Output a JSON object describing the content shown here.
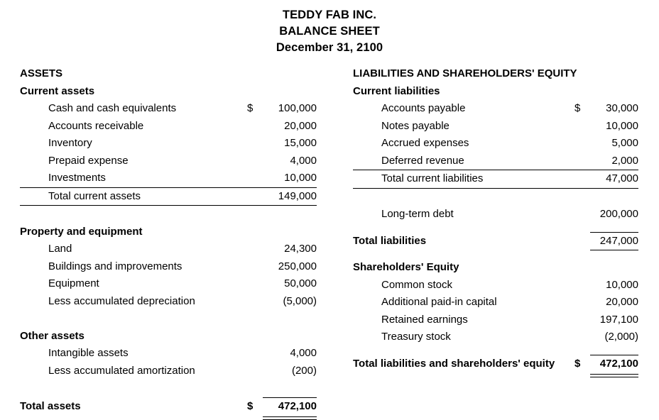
{
  "header": {
    "company": "TEDDY FAB INC.",
    "statement": "BALANCE SHEET",
    "date": "December 31, 2100"
  },
  "currency_symbol": "$",
  "left_column": {
    "title": "ASSETS",
    "sections": [
      {
        "heading": "Current assets",
        "items": [
          {
            "label": "Cash and cash equivalents",
            "currency": "$",
            "amount": "100,000"
          },
          {
            "label": "Accounts receivable",
            "currency": "",
            "amount": "20,000"
          },
          {
            "label": "Inventory",
            "currency": "",
            "amount": "15,000"
          },
          {
            "label": "Prepaid expense",
            "currency": "",
            "amount": "4,000"
          },
          {
            "label": "Investments",
            "currency": "",
            "amount": "10,000"
          }
        ],
        "total": {
          "label": "Total current assets",
          "currency": "",
          "amount": "149,000"
        }
      },
      {
        "heading": "Property and equipment",
        "items": [
          {
            "label": "Land",
            "currency": "",
            "amount": "24,300"
          },
          {
            "label": "Buildings and improvements",
            "currency": "",
            "amount": "250,000"
          },
          {
            "label": "Equipment",
            "currency": "",
            "amount": "50,000"
          },
          {
            "label": "Less accumulated depreciation",
            "currency": "",
            "amount": "(5,000)"
          }
        ]
      },
      {
        "heading": "Other assets",
        "items": [
          {
            "label": "Intangible assets",
            "currency": "",
            "amount": "4,000"
          },
          {
            "label": "Less accumulated amortization",
            "currency": "",
            "amount": "(200)"
          }
        ]
      }
    ],
    "grand_total": {
      "label": "Total assets",
      "currency": "$",
      "amount": "472,100"
    }
  },
  "right_column": {
    "title": "LIABILITIES AND SHAREHOLDERS' EQUITY",
    "current_liabilities": {
      "heading": "Current liabilities",
      "items": [
        {
          "label": "Accounts payable",
          "currency": "$",
          "amount": "30,000"
        },
        {
          "label": "Notes payable",
          "currency": "",
          "amount": "10,000"
        },
        {
          "label": "Accrued expenses",
          "currency": "",
          "amount": "5,000"
        },
        {
          "label": "Deferred revenue",
          "currency": "",
          "amount": "2,000"
        }
      ],
      "total": {
        "label": "Total current liabilities",
        "currency": "",
        "amount": "47,000"
      }
    },
    "long_term_debt": {
      "label": "Long-term debt",
      "currency": "",
      "amount": "200,000"
    },
    "total_liabilities": {
      "label": "Total liabilities",
      "currency": "",
      "amount": "247,000"
    },
    "equity": {
      "heading": "Shareholders' Equity",
      "items": [
        {
          "label": "Common stock",
          "currency": "",
          "amount": "10,000"
        },
        {
          "label": "Additional paid-in capital",
          "currency": "",
          "amount": "20,000"
        },
        {
          "label": "Retained earnings",
          "currency": "",
          "amount": "197,100"
        },
        {
          "label": "Treasury stock",
          "currency": "",
          "amount": "(2,000)"
        }
      ]
    },
    "grand_total": {
      "label": "Total liabilities and shareholders' equity",
      "currency": "$",
      "amount": "472,100"
    }
  }
}
